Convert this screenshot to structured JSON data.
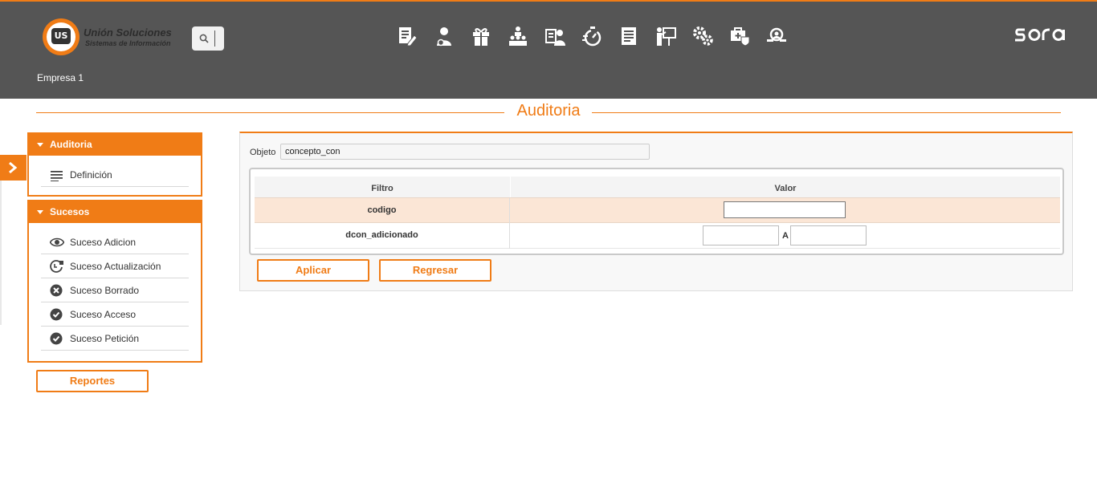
{
  "header": {
    "logo": {
      "brand": "Unión Soluciones",
      "subtitle": "Sistemas de Información",
      "badge": "US"
    },
    "search": {
      "icon": "search-icon"
    },
    "modules": [
      "document-edit-icon",
      "user-settings-icon",
      "gift-icon",
      "team-hierarchy-icon",
      "id-badge-user-icon",
      "timer-icon",
      "report-document-icon",
      "presentation-icon",
      "gears-icon",
      "medical-briefcase-icon",
      "audit-magnifier-icon"
    ],
    "product_logo": "sora",
    "company": "Empresa 1"
  },
  "page": {
    "title": "Auditoria"
  },
  "sidebar": {
    "toggle_icon": "chevron-right-icon",
    "panels": [
      {
        "title": "Auditoria",
        "items": [
          {
            "label": "Definición",
            "icon": "list-icon"
          }
        ]
      },
      {
        "title": "Sucesos",
        "items": [
          {
            "label": "Suceso Adicion",
            "icon": "eye-icon"
          },
          {
            "label": "Suceso Actualización",
            "icon": "history-edit-icon"
          },
          {
            "label": "Suceso Borrado",
            "icon": "delete-circle-icon"
          },
          {
            "label": "Suceso Acceso",
            "icon": "check-circle-icon"
          },
          {
            "label": "Suceso Petición",
            "icon": "check-circle-icon"
          }
        ]
      }
    ],
    "reports_button": "Reportes"
  },
  "form": {
    "object_label": "Objeto",
    "object_value": "concepto_con",
    "grid": {
      "columns": [
        "Filtro",
        "Valor"
      ],
      "rows": [
        {
          "filter": "codigo",
          "value": ""
        },
        {
          "filter": "dcon_adicionado",
          "from": "",
          "range_label": "A",
          "to": ""
        }
      ]
    },
    "apply_button": "Aplicar",
    "back_button": "Regresar"
  },
  "colors": {
    "accent": "#f07c16",
    "header_bg": "#555555",
    "highlight_row": "#fbe6d6"
  }
}
